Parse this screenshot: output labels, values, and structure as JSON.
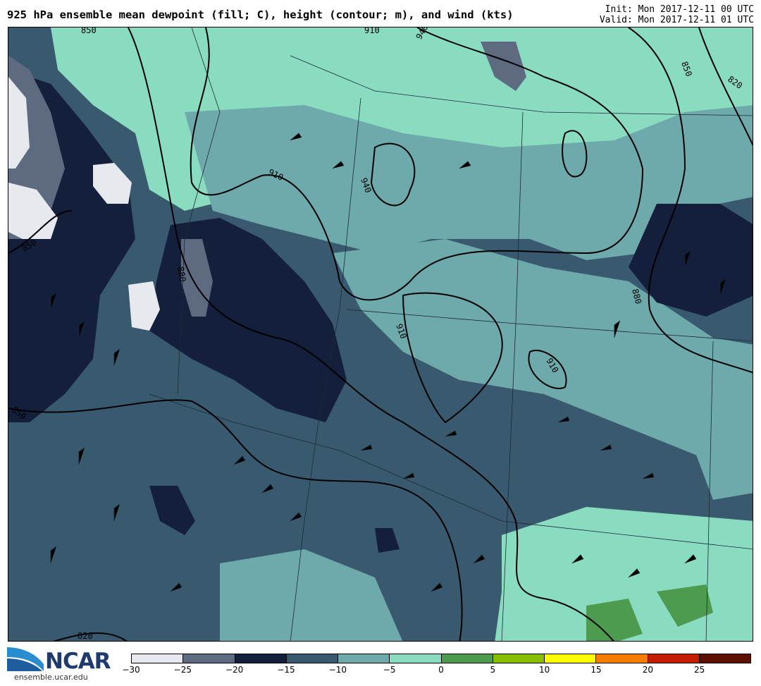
{
  "header": {
    "title": "925 hPa ensemble mean dewpoint (fill; C), height (contour; m), and wind (kts)",
    "init": "Init: Mon 2017-12-11 00 UTC",
    "valid": "Valid: Mon 2017-12-11 01 UTC"
  },
  "logo": {
    "name": "NCAR",
    "url": "ensemble.ucar.edu"
  },
  "colorbar": {
    "ticks": [
      "−30",
      "−25",
      "−20",
      "−15",
      "−10",
      "−5",
      "0",
      "5",
      "10",
      "15",
      "20",
      "25"
    ],
    "colors": [
      "#e6e9ee",
      "#5e6a80",
      "#141f3c",
      "#395a6e",
      "#6ea9ab",
      "#8adcc0",
      "#4c9b4e",
      "#88be00",
      "#fdfd00",
      "#f47c00",
      "#c21d00",
      "#5e1000"
    ]
  },
  "map": {
    "contour_labels": [
      "850",
      "910",
      "940",
      "850",
      "820",
      "910",
      "940",
      "880",
      "850",
      "880",
      "910",
      "910",
      "850",
      "820"
    ],
    "palette": {
      "water": "#2a4a64",
      "light": "#8adcc0",
      "mid": "#6ea9ab",
      "dark": "#395a6e",
      "deep": "#141f3c",
      "grey": "#5e6a80",
      "white": "#e6e9ee",
      "green": "#4c9b4e"
    }
  }
}
